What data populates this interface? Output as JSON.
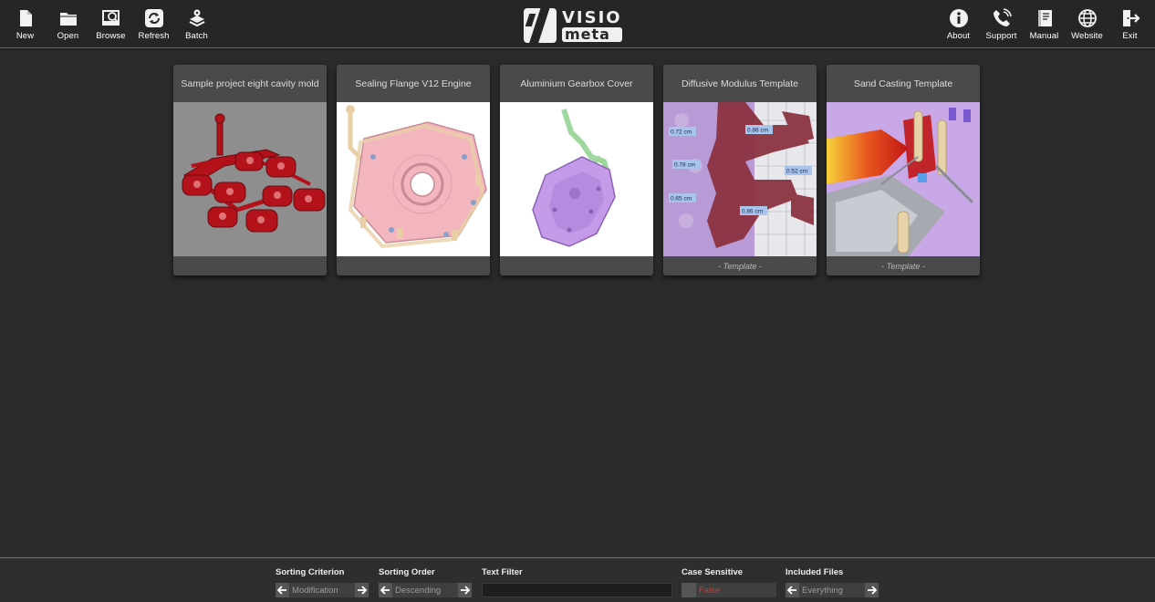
{
  "toolbar": {
    "left": [
      {
        "label": "New",
        "icon": "new-file-icon"
      },
      {
        "label": "Open",
        "icon": "folder-open-icon"
      },
      {
        "label": "Browse",
        "icon": "browse-icon"
      },
      {
        "label": "Refresh",
        "icon": "refresh-icon"
      },
      {
        "label": "Batch",
        "icon": "batch-icon"
      }
    ],
    "right": [
      {
        "label": "About",
        "icon": "info-icon"
      },
      {
        "label": "Support",
        "icon": "phone-icon"
      },
      {
        "label": "Manual",
        "icon": "book-icon"
      },
      {
        "label": "Website",
        "icon": "globe-icon"
      },
      {
        "label": "Exit",
        "icon": "exit-icon"
      }
    ],
    "logo": {
      "line1": "VISIO",
      "line2": "meta"
    }
  },
  "projects": [
    {
      "title": "Sample project eight cavity mold",
      "footer": "",
      "thumb": "red-eight-cavity-mold"
    },
    {
      "title": "Sealing Flange V12 Engine",
      "footer": "",
      "thumb": "pink-sealing-flange"
    },
    {
      "title": "Aluminium Gearbox Cover",
      "footer": "",
      "thumb": "purple-gearbox-cover"
    },
    {
      "title": "Diffusive Modulus Template",
      "footer": "- Template -",
      "thumb": "modulus-measurements"
    },
    {
      "title": "Sand Casting Template",
      "footer": "- Template -",
      "thumb": "sand-casting-heatmap"
    }
  ],
  "modulus_labels": [
    "0.72 cm",
    "0.86 cm",
    "0.78 cm",
    "0.52 cm",
    "0.65 cm",
    "0.86 cm"
  ],
  "bottom": {
    "sorting_criterion": {
      "label": "Sorting Criterion",
      "value": "Modification"
    },
    "sorting_order": {
      "label": "Sorting Order",
      "value": "Descending"
    },
    "text_filter": {
      "label": "Text Filter",
      "value": ""
    },
    "case_sensitive": {
      "label": "Case Sensitive",
      "value": "False"
    },
    "included_files": {
      "label": "Included Files",
      "value": "Everything"
    }
  },
  "colors": {
    "background": "#2b2b2b",
    "toolbar": "#262626",
    "card": "#4a4a4a",
    "case_false": "#d23a3a"
  }
}
